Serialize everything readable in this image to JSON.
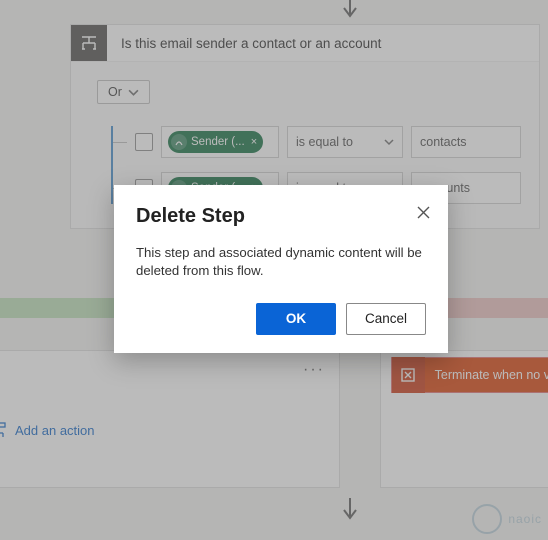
{
  "condition": {
    "title": "Is this email sender a contact or an account",
    "logic": "Or",
    "rows": [
      {
        "token": "Sender (...",
        "operator": "is equal to",
        "value": "contacts"
      },
      {
        "token": "Sender (...",
        "operator": "is equal to",
        "value": "accounts"
      }
    ]
  },
  "branches": {
    "no_overflow_char": "o",
    "terminate_label": "Terminate when no val",
    "add_action_label": "Add an action",
    "more_label": "···"
  },
  "dialog": {
    "title": "Delete Step",
    "body": "This step and associated dynamic content will be deleted from this flow.",
    "ok": "OK",
    "cancel": "Cancel"
  },
  "logo": {
    "text": "naoic"
  }
}
